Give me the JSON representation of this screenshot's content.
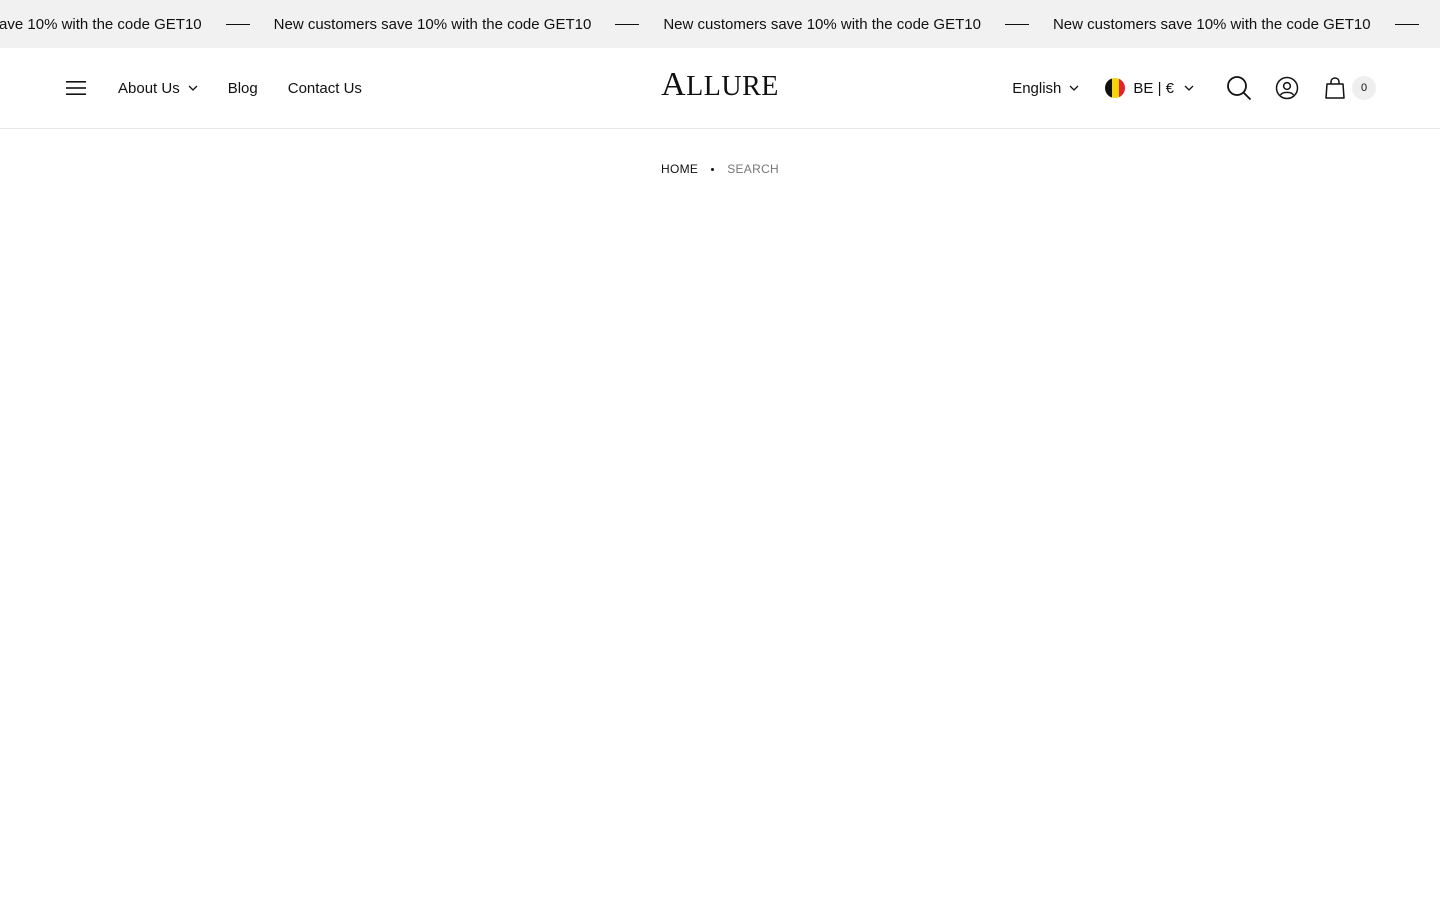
{
  "announcement": {
    "text": "New customers save 10% with the code GET10",
    "repeat_count": 5
  },
  "header": {
    "nav": {
      "about_label": "About Us",
      "blog_label": "Blog",
      "contact_label": "Contact Us"
    },
    "logo": {
      "first_letter": "A",
      "rest": "LLURE"
    },
    "language": {
      "selected": "English"
    },
    "currency": {
      "selected": "BE | €",
      "flag_colors": [
        "#111111",
        "#f5d20a",
        "#e3232e"
      ]
    },
    "cart": {
      "count": "0"
    }
  },
  "breadcrumb": {
    "home": "HOME",
    "current": "SEARCH"
  },
  "colors": {
    "announcement_bg": "#f1f1f1",
    "border": "#e7e7e7",
    "muted_text": "#777777"
  }
}
